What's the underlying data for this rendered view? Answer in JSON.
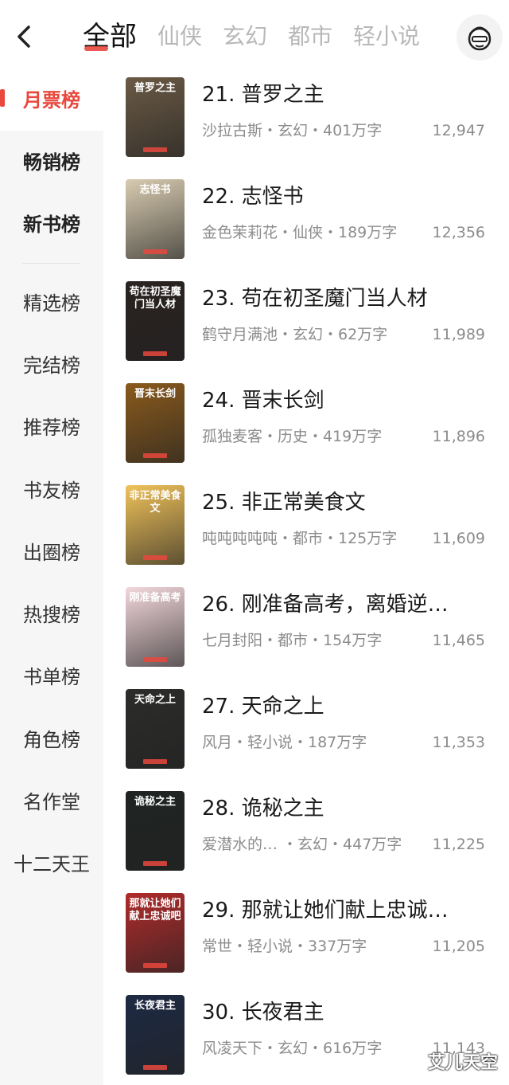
{
  "header": {
    "tabs": [
      {
        "label": "全部",
        "active": true
      },
      {
        "label": "仙侠",
        "active": false
      },
      {
        "label": "玄幻",
        "active": false
      },
      {
        "label": "都市",
        "active": false
      },
      {
        "label": "轻小说",
        "active": false
      }
    ]
  },
  "sidebar": {
    "items": [
      {
        "label": "月票榜"
      },
      {
        "label": "畅销榜"
      },
      {
        "label": "新书榜"
      },
      {
        "label": "精选榜"
      },
      {
        "label": "完结榜"
      },
      {
        "label": "推荐榜"
      },
      {
        "label": "书友榜"
      },
      {
        "label": "出圈榜"
      },
      {
        "label": "热搜榜"
      },
      {
        "label": "书单榜"
      },
      {
        "label": "角色榜"
      },
      {
        "label": "名作堂"
      },
      {
        "label": "十二天王"
      }
    ],
    "active_color": "#e8483d"
  },
  "books": [
    {
      "title": "21. 普罗之主",
      "meta": "沙拉古斯・玄幻・401万字",
      "count": "12,947",
      "cover_text": "普罗之主",
      "cover_color": "#6b5a45"
    },
    {
      "title": "22. 志怪书",
      "meta": "金色茉莉花・仙侠・189万字",
      "count": "12,356",
      "cover_text": "志怪书",
      "cover_color": "#d8cbb0"
    },
    {
      "title": "23. 苟在初圣魔门当人材",
      "meta": "鹤守月满池・玄幻・62万字",
      "count": "11,989",
      "cover_text": "苟在初圣魔门当人材",
      "cover_color": "#2a2320"
    },
    {
      "title": "24. 晋末长剑",
      "meta": "孤独麦客・历史・419万字",
      "count": "11,896",
      "cover_text": "晋末长剑",
      "cover_color": "#8a5a1c"
    },
    {
      "title": "25. 非正常美食文",
      "meta": "吨吨吨吨吨・都市・125万字",
      "count": "11,609",
      "cover_text": "非正常美食文",
      "cover_color": "#f0c25a"
    },
    {
      "title": "26. 刚准备高考，离婚逆…",
      "meta": "七月封阳・都市・154万字",
      "count": "11,465",
      "cover_text": "刚准备高考",
      "cover_color": "#f3d8dc"
    },
    {
      "title": "27. 天命之上",
      "meta": "风月・轻小说・187万字",
      "count": "11,353",
      "cover_text": "天命之上",
      "cover_color": "#2c2c2a"
    },
    {
      "title": "28. 诡秘之主",
      "meta": "爱潜水的… ・玄幻・447万字",
      "count": "11,225",
      "cover_text": "诡秘之主",
      "cover_color": "#1f2422"
    },
    {
      "title": "29. 那就让她们献上忠诚…",
      "meta": "常世・轻小说・337万字",
      "count": "11,205",
      "cover_text": "那就让她们献上忠诚吧",
      "cover_color": "#b12b2b"
    },
    {
      "title": "30. 长夜君主",
      "meta": "风凌天下・玄幻・616万字",
      "count": "11,143",
      "cover_text": "长夜君主",
      "cover_color": "#1d2a44"
    }
  ],
  "watermark": "艾儿天空"
}
